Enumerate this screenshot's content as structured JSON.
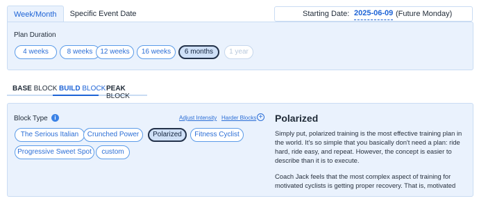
{
  "top_tabs": [
    {
      "label": "Week/Month",
      "active": true
    },
    {
      "label": "Specific Event Date",
      "active": false
    }
  ],
  "start_date": {
    "label": "Starting Date:",
    "value": "2025-06-09",
    "note": "(Future Monday)"
  },
  "plan_duration": {
    "label": "Plan Duration",
    "options": [
      {
        "label": "4 weeks"
      },
      {
        "label": "8 weeks"
      },
      {
        "label": "12 weeks"
      },
      {
        "label": "16 weeks"
      },
      {
        "label": "6 months",
        "selected": true
      },
      {
        "label": "1 year",
        "disabled": true
      }
    ]
  },
  "block_tabs": [
    {
      "bold": "BASE",
      "rest": " BLOCK"
    },
    {
      "bold": "BUILD",
      "rest": " BLOCK",
      "active": true
    },
    {
      "bold": "PEAK",
      "rest": " BLOCK"
    }
  ],
  "block_panel": {
    "label": "Block Type",
    "info_icon": "info-icon",
    "adjust_link": "Adjust Intensity",
    "harder_link": "Harder Blocks",
    "types": [
      {
        "label": "The Serious Italian"
      },
      {
        "label": "Crunched Power"
      },
      {
        "label": "Polarized",
        "selected": true
      },
      {
        "label": "Fitness Cyclist"
      },
      {
        "label": "Progressive Sweet Spot"
      },
      {
        "label": "custom"
      }
    ]
  },
  "description": {
    "title": "Polarized",
    "paragraphs": [
      "Simply put, polarized training is the most effective training plan in the world. It's so simple that you basically don't need a plan: ride hard, ride easy, and repeat. However, the concept is easier to describe than it is to execute.",
      "Coach Jack feels that the most complex aspect of training for motivated cyclists is getting proper recovery. That is, motivated"
    ]
  },
  "colors": {
    "accent": "#1d63d6",
    "panel_bg": "#eaf2fd",
    "border": "#c9dcf3"
  }
}
